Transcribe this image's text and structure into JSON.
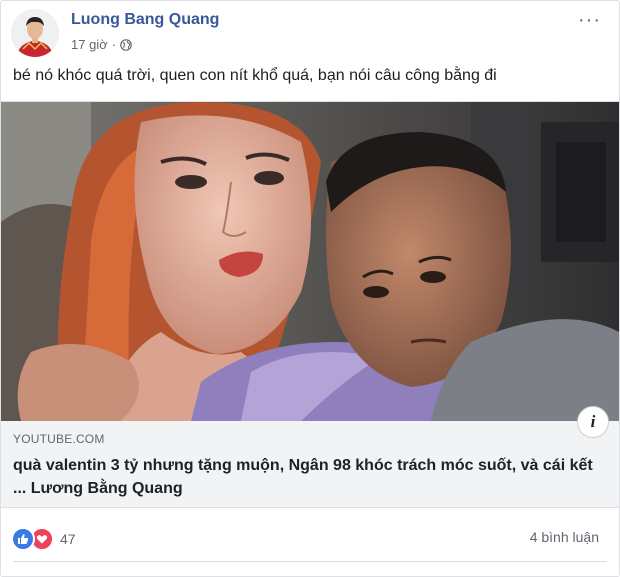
{
  "post": {
    "author": "Luong Bang Quang",
    "time": "17 giờ",
    "separator": "·",
    "privacy_icon": "globe-icon",
    "more_icon": "more-horizontal-icon",
    "more_label": "···",
    "text": "bé nó khóc quá trời, quen con nít khổ quá, bạn nói câu công bằng đi"
  },
  "link_preview": {
    "domain": "YOUTUBE.COM",
    "title": "quà valentin 3 tỷ nhưng tặng muộn, Ngân 98 khóc trách móc suốt, và cái kết ... Lương Bằng Quang",
    "info_label": "i"
  },
  "footer": {
    "reaction_icons": [
      "like-icon",
      "love-icon"
    ],
    "reaction_count": "47",
    "comments": "4 bình luận"
  },
  "colors": {
    "author": "#385898",
    "like": "#3b7ae5",
    "love": "#ee4356",
    "meta": "#616770"
  }
}
